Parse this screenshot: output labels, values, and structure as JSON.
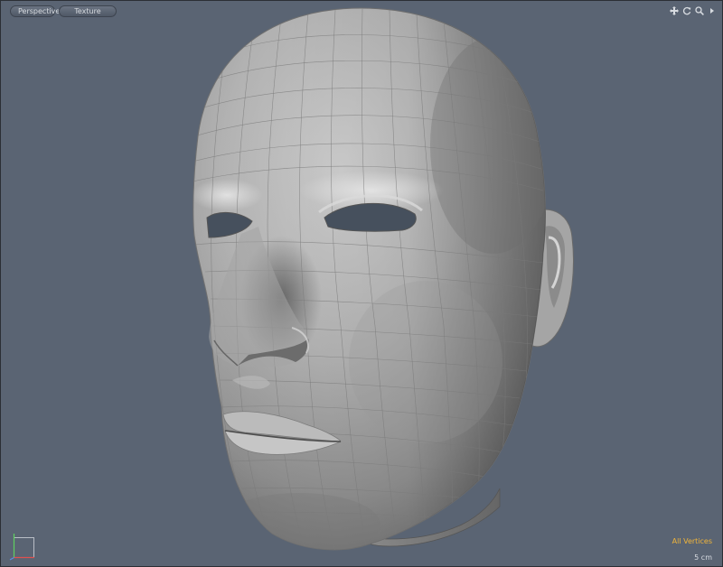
{
  "viewport": {
    "tabs": [
      {
        "label": "Perspective"
      },
      {
        "label": "Texture"
      }
    ],
    "tools": {
      "icons": [
        "pan-icon",
        "rotate-icon",
        "zoom-icon",
        "menu-arrow-icon"
      ]
    },
    "status": {
      "selection": "All Vertices",
      "scale": "5 cm"
    },
    "colors": {
      "background": "#5a6473",
      "mesh": "#a9a9a9",
      "selection_text": "#f1b53a"
    }
  }
}
